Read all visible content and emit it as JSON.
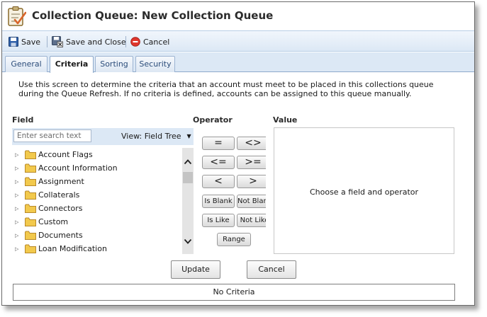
{
  "window": {
    "title": "Collection Queue: New Collection Queue"
  },
  "toolbar": {
    "save_label": "Save",
    "save_close_label": "Save and Close",
    "cancel_label": "Cancel"
  },
  "tabs": [
    {
      "label": "General",
      "active": false
    },
    {
      "label": "Criteria",
      "active": true
    },
    {
      "label": "Sorting",
      "active": false
    },
    {
      "label": "Security",
      "active": false
    }
  ],
  "criteria": {
    "description": "Use this screen to determine the criteria that an account must meet to be placed in this collections queue during the Queue Refresh. If no criteria is defined, accounts can be assigned to this queue manually.",
    "field_label": "Field",
    "operator_label": "Operator",
    "value_label": "Value",
    "search_placeholder": "Enter search text",
    "view_label": "View: Field Tree",
    "tree_items": [
      "Account Flags",
      "Account Information",
      "Assignment",
      "Collaterals",
      "Connectors",
      "Custom",
      "Documents",
      "Loan Modification"
    ],
    "operators": [
      "=",
      "<>",
      "<=",
      ">=",
      "<",
      ">",
      "Is Blank",
      "Not Blank",
      "Is Like",
      "Not Like",
      "Range"
    ],
    "value_message": "Choose a field and operator",
    "update_label": "Update",
    "cancel_label": "Cancel",
    "criteria_summary": "No Criteria"
  },
  "colors": {
    "toolbar_bg": "#dce8f5",
    "tab_text": "#2c4d7a",
    "folder": "#f2c94c"
  }
}
